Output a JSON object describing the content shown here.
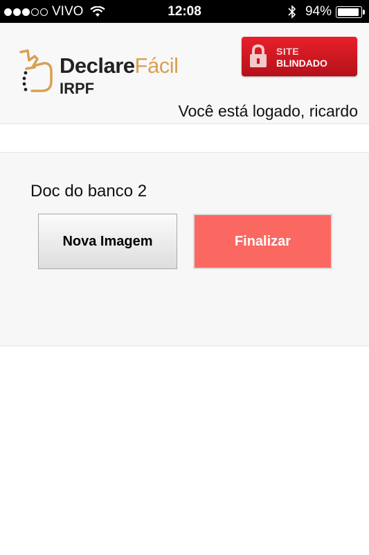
{
  "status_bar": {
    "carrier": "VIVO",
    "time": "12:08",
    "battery_percent": "94%",
    "signal_dots_filled": 3,
    "signal_dots_total": 5,
    "battery_level": 0.94
  },
  "header": {
    "brand_part1": "Declare",
    "brand_part2": "Fácil",
    "brand_sub": "IRPF",
    "seal_line1": "SITE",
    "seal_line2": "BLINDADO",
    "logged_text": "Você está logado, ricardo",
    "brand_colors": {
      "dark": "#222222",
      "accent": "#d9a050",
      "seal_red": "#d41a22"
    }
  },
  "main": {
    "doc_title": "Doc do banco 2",
    "new_image_label": "Nova Imagem",
    "finish_label": "Finalizar",
    "finish_color": "#fb6862"
  }
}
